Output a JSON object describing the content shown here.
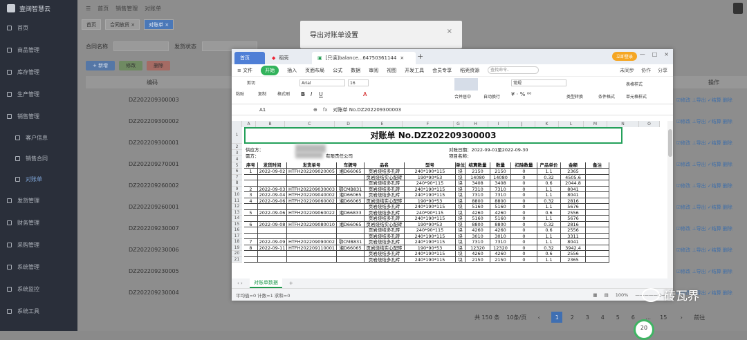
{
  "sidebar": {
    "brand": "壹阔智慧云",
    "items": [
      "首页",
      "商品管理",
      "库存管理",
      "生产管理",
      "销售管理",
      "客户信息",
      "销售合同",
      "对账单",
      "发货管理",
      "财务管理",
      "采购管理",
      "系统管理",
      "系统监控",
      "系统工具"
    ]
  },
  "header": {
    "home": "首页",
    "crumb1": "销售管理",
    "crumb2": "对账单"
  },
  "tabs": [
    "首页",
    "合同放货 ×",
    "对账单 ×"
  ],
  "filter": {
    "label1": "合同名称",
    "placeholder1": "请输入合同名称",
    "label2": "发货状态"
  },
  "buttons": {
    "add": "+ 新增",
    "edit": "修改",
    "del": "删除"
  },
  "table": {
    "col_id": "编码",
    "col_ops": "操作",
    "ids": [
      "DZ202209300003",
      "DZ202209300002",
      "DZ202209300001",
      "DZ202209270001",
      "DZ202209260002",
      "DZ202209260001",
      "DZ202209230007",
      "DZ202209230006",
      "DZ202209230005",
      "DZ202209230004"
    ],
    "ops": "☑修改 ⊥导出 ✓结算 删除"
  },
  "pager": {
    "total": "共 150 条",
    "size": "10条/页",
    "pages": [
      "1",
      "2",
      "3",
      "4",
      "5",
      "6",
      "...",
      "15"
    ],
    "goto": "前往"
  },
  "dialog": {
    "title": "导出对账单设置",
    "close": "×"
  },
  "wps": {
    "tab_home": "首页",
    "tab_doc": "稻壳",
    "tab_file": "[只读]balance...64750361144",
    "login": "立即登录",
    "menus": [
      "≡ 文件",
      "开始",
      "插入",
      "页面布局",
      "公式",
      "数据",
      "审阅",
      "视图",
      "开发工具",
      "会员专享",
      "稻壳资源"
    ],
    "search": "查找命令、",
    "menu_right": [
      "未同步",
      "协作",
      "分享"
    ],
    "ribbon": {
      "cut": "剪切",
      "paste": "粘贴",
      "copy": "复制",
      "brush": "格式刷",
      "font": "Arial",
      "size": "16",
      "merge": "合并居中",
      "wrap": "自动换行",
      "numfmt": "常规",
      "convert": "类型转换",
      "cond": "条件格式",
      "tblstyle": "表格样式",
      "cellstyle": "单元格样式"
    },
    "cellref": "A1",
    "fx": "fx",
    "formula": "对账单 No.DZ202209300003",
    "cols": [
      "A",
      "B",
      "C",
      "D",
      "E",
      "F",
      "G",
      "H",
      "I",
      "J",
      "K",
      "L",
      "M",
      "N",
      "O"
    ],
    "sheet_title": "对账单 No.DZ202209300003",
    "supplier": "供应方：",
    "buyer": "需方：",
    "buyer_name": "有限责任公司",
    "period": "对账日期：2022-09-01至2022-09-30",
    "project": "项目名称：",
    "headers": [
      "序号",
      "发货时间",
      "发货单号",
      "车牌号",
      "品名",
      "型号",
      "单位",
      "结算数量",
      "数量",
      "扣除数量",
      "产品单价",
      "金额",
      "备注"
    ],
    "rows": [
      [
        "1",
        "2022-09-02",
        "HTFH202209020005",
        "湘D66065",
        "页岩烧结多孔砖",
        "240*190*115",
        "块",
        "2150",
        "2150",
        "0",
        "1.1",
        "2365",
        ""
      ],
      [
        "",
        "",
        "",
        "",
        "页岩烧结实心配砖",
        "190*90*53",
        "块",
        "14080",
        "14080",
        "0",
        "0.32",
        "4505.6",
        ""
      ],
      [
        "",
        "",
        "",
        "",
        "页岩烧结多孔砖",
        "240*90*115",
        "块",
        "3408",
        "3408",
        "0",
        "0.6",
        "2044.8",
        ""
      ],
      [
        "2",
        "2022-09-03",
        "HTFH202209030003",
        "鄂CMB831",
        "页岩烧结多孔砖",
        "240*190*115",
        "块",
        "7310",
        "7310",
        "0",
        "1.1",
        "8041",
        ""
      ],
      [
        "3",
        "2022-09-04",
        "HTFH202209040002",
        "湘D66065",
        "页岩烧结多孔砖",
        "240*190*115",
        "块",
        "7310",
        "7310",
        "0",
        "1.1",
        "8041",
        ""
      ],
      [
        "4",
        "2022-09-06",
        "HTFH202209060002",
        "湘D66065",
        "页岩烧结实心配砖",
        "190*90*53",
        "块",
        "8800",
        "8800",
        "0",
        "0.32",
        "2816",
        ""
      ],
      [
        "",
        "",
        "",
        "",
        "页岩烧结多孔砖",
        "240*190*115",
        "块",
        "5160",
        "5160",
        "0",
        "1.1",
        "5676",
        ""
      ],
      [
        "5",
        "2022-09-06",
        "HTFH202209060022",
        "湘D66833",
        "页岩烧结多孔砖",
        "240*90*115",
        "块",
        "4260",
        "4260",
        "0",
        "0.6",
        "2556",
        ""
      ],
      [
        "",
        "",
        "",
        "",
        "页岩烧结多孔砖",
        "240*190*115",
        "块",
        "5160",
        "5160",
        "0",
        "1.1",
        "5676",
        ""
      ],
      [
        "6",
        "2022-09-08",
        "HTFH202209080010",
        "湘D66065",
        "页岩烧结实心配砖",
        "190*90*53",
        "块",
        "8800",
        "8800",
        "0",
        "0.32",
        "2816",
        ""
      ],
      [
        "",
        "",
        "",
        "",
        "页岩烧结多孔砖",
        "240*90*115",
        "块",
        "4260",
        "4260",
        "0",
        "0.6",
        "2556",
        ""
      ],
      [
        "",
        "",
        "",
        "",
        "页岩烧结多孔砖",
        "240*190*115",
        "块",
        "3010",
        "3010",
        "0",
        "1.1",
        "3311",
        ""
      ],
      [
        "7",
        "2022-09-09",
        "HTFH202209090002",
        "鄂CMB831",
        "页岩烧结多孔砖",
        "240*190*115",
        "块",
        "7310",
        "7310",
        "0",
        "1.1",
        "8041",
        ""
      ],
      [
        "8",
        "2022-09-11",
        "HTFH202209110001",
        "湘D66065",
        "页岩烧结实心配砖",
        "190*90*53",
        "块",
        "12320",
        "12320",
        "0",
        "0.32",
        "3942.4",
        ""
      ],
      [
        "",
        "",
        "",
        "",
        "页岩烧结多孔砖",
        "240*190*115",
        "块",
        "4260",
        "4260",
        "0",
        "0.6",
        "2556",
        ""
      ],
      [
        "",
        "",
        "",
        "",
        "页岩烧结多孔砖",
        "240*190*115",
        "块",
        "2150",
        "2150",
        "0",
        "1.1",
        "2365",
        ""
      ]
    ],
    "sheet_tab": "对账单数据",
    "status_left": "平均值=0  计数=1  求和=0",
    "zoom": "100%"
  },
  "watermark": "砖瓦界",
  "badge": "20"
}
